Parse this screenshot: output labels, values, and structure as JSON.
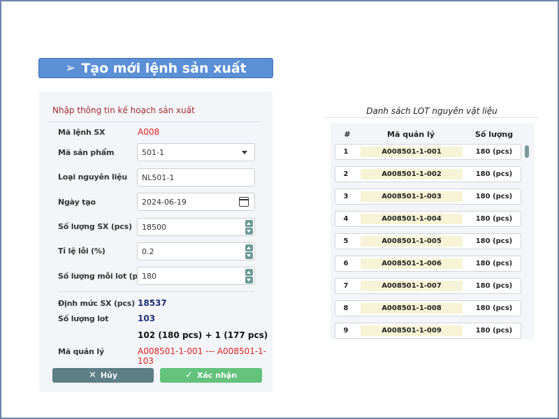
{
  "title": "Tạo mới lệnh sản xuất",
  "form": {
    "heading": "Nhập thông tin kế hoạch sản xuất",
    "labels": {
      "order_code": "Mã lệnh SX",
      "product_code": "Mã sản phẩm",
      "material_type": "Loại nguyên liệu",
      "created_date": "Ngày tạo",
      "production_qty": "Số lượng SX (pcs)",
      "defect_rate": "Tỉ lệ lỗi (%)",
      "qty_per_lot": "Số lượng mỗi lot (pcs)",
      "production_norm": "Định mức SX (pcs)",
      "lot_count": "Số lượng lot",
      "mgmt_code": "Mã quản lý"
    },
    "values": {
      "order_code": "A008",
      "product_code": "501-1",
      "material_type": "NL501-1",
      "created_date": "2024-06-19",
      "production_qty": "18500",
      "defect_rate": "0.2",
      "qty_per_lot": "180",
      "production_norm": "18537",
      "lot_count": "103",
      "lot_breakdown": "102 (180 pcs) + 1 (177 pcs)",
      "mgmt_code": "A008501-1-001 --- A008501-1-103"
    },
    "buttons": {
      "cancel": "Hủy",
      "confirm": "Xác nhận"
    },
    "colors": {
      "cancel": "#5d7f86",
      "confirm": "#63c27b",
      "heading": "#a52a2a"
    }
  },
  "lot_list": {
    "title": "Danh sách LOT nguyên vật liệu",
    "headers": [
      "#",
      "Mã quản lý",
      "Số lượng"
    ],
    "rows": [
      {
        "no": "1",
        "code": "A008501-1-001",
        "qty": "180 (pcs)"
      },
      {
        "no": "2",
        "code": "A008501-1-002",
        "qty": "180 (pcs)"
      },
      {
        "no": "3",
        "code": "A008501-1-003",
        "qty": "180 (pcs)"
      },
      {
        "no": "4",
        "code": "A008501-1-004",
        "qty": "180 (pcs)"
      },
      {
        "no": "5",
        "code": "A008501-1-005",
        "qty": "180 (pcs)"
      },
      {
        "no": "6",
        "code": "A008501-1-006",
        "qty": "180 (pcs)"
      },
      {
        "no": "7",
        "code": "A008501-1-007",
        "qty": "180 (pcs)"
      },
      {
        "no": "8",
        "code": "A008501-1-008",
        "qty": "180 (pcs)"
      },
      {
        "no": "9",
        "code": "A008501-1-009",
        "qty": "180 (pcs)"
      }
    ]
  },
  "icons": {
    "title": "arrow-right-icon",
    "cancel": "close-icon",
    "confirm": "check-icon",
    "date": "calendar-icon",
    "select": "chevron-down-icon"
  }
}
